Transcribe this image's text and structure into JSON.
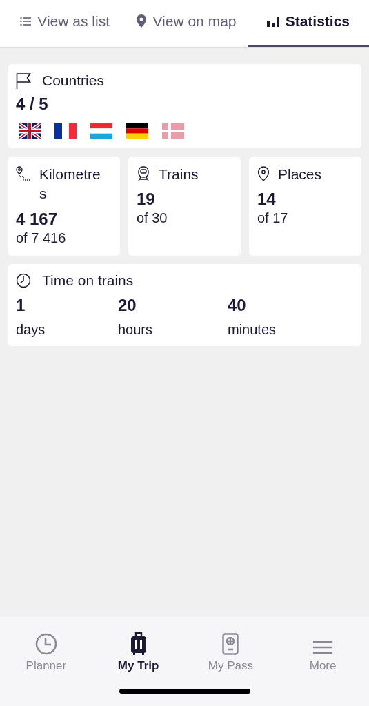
{
  "tabs": [
    {
      "label": "View as list",
      "kind": "list",
      "selected": false
    },
    {
      "label": "View on map",
      "kind": "pin",
      "selected": false
    },
    {
      "label": "Statistics",
      "kind": "bars",
      "selected": true
    }
  ],
  "countries": {
    "title": "Countries",
    "count": "4 / 5",
    "flags": [
      {
        "kind": "uk",
        "visited": true
      },
      {
        "kind": "fr",
        "visited": true
      },
      {
        "kind": "lu",
        "visited": true
      },
      {
        "kind": "de",
        "visited": true
      },
      {
        "kind": "dk",
        "visited": false
      }
    ]
  },
  "stats": [
    {
      "kind": "route",
      "title": "Kilometres",
      "value": "4 167",
      "total": "of 7 416"
    },
    {
      "kind": "train",
      "title": "Trains",
      "value": "19",
      "total": "of 30"
    },
    {
      "kind": "pin",
      "title": "Places",
      "value": "14",
      "total": "of 17"
    }
  ],
  "time": {
    "title": "Time on trains",
    "parts": [
      {
        "value": "1",
        "unit": "days"
      },
      {
        "value": "20",
        "unit": "hours"
      },
      {
        "value": "40",
        "unit": "minutes"
      }
    ]
  },
  "nav": [
    {
      "label": "Planner",
      "kind": "clock",
      "selected": false
    },
    {
      "label": "My Trip",
      "kind": "suitcase",
      "selected": true
    },
    {
      "label": "My Pass",
      "kind": "passport",
      "selected": false
    },
    {
      "label": "More",
      "kind": "menu",
      "selected": false
    }
  ]
}
